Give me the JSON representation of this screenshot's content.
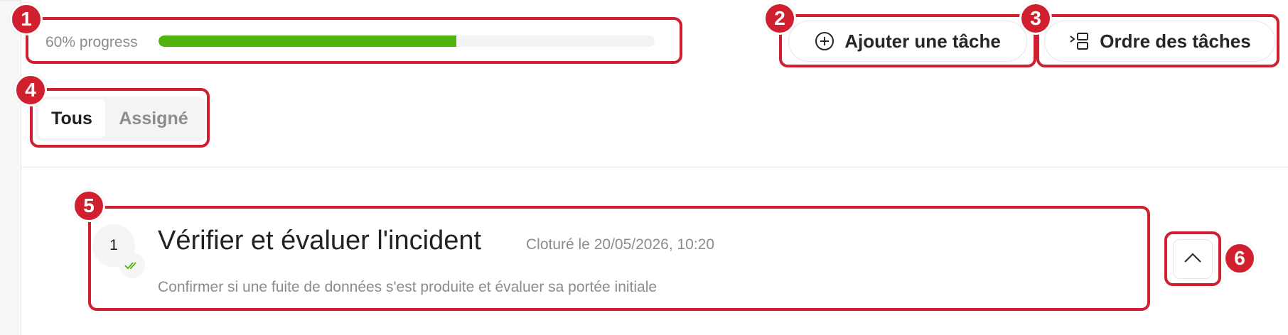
{
  "progress": {
    "label": "60% progress",
    "value": 0.6
  },
  "buttons": {
    "add_task": {
      "label": "Ajouter une tâche",
      "icon": "plus-circle-icon"
    },
    "task_order": {
      "label": "Ordre des tâches",
      "icon": "reorder-icon"
    }
  },
  "filter": {
    "options": [
      "Tous",
      "Assigné"
    ],
    "selected": "Tous"
  },
  "task": {
    "number": "1",
    "title": "Vérifier et évaluer l'incident",
    "meta": "Cloturé le 20/05/2026, 10:20",
    "description": "Confirmer si une fuite de données s'est produite et évaluer sa portée initiale",
    "status_icon": "double-check-icon"
  },
  "collapse": {
    "icon": "chevron-up-icon"
  },
  "annotations": [
    "1",
    "2",
    "3",
    "4",
    "5",
    "6"
  ],
  "colors": {
    "accent_red": "#d0202f",
    "progress_green": "#52b20e"
  }
}
